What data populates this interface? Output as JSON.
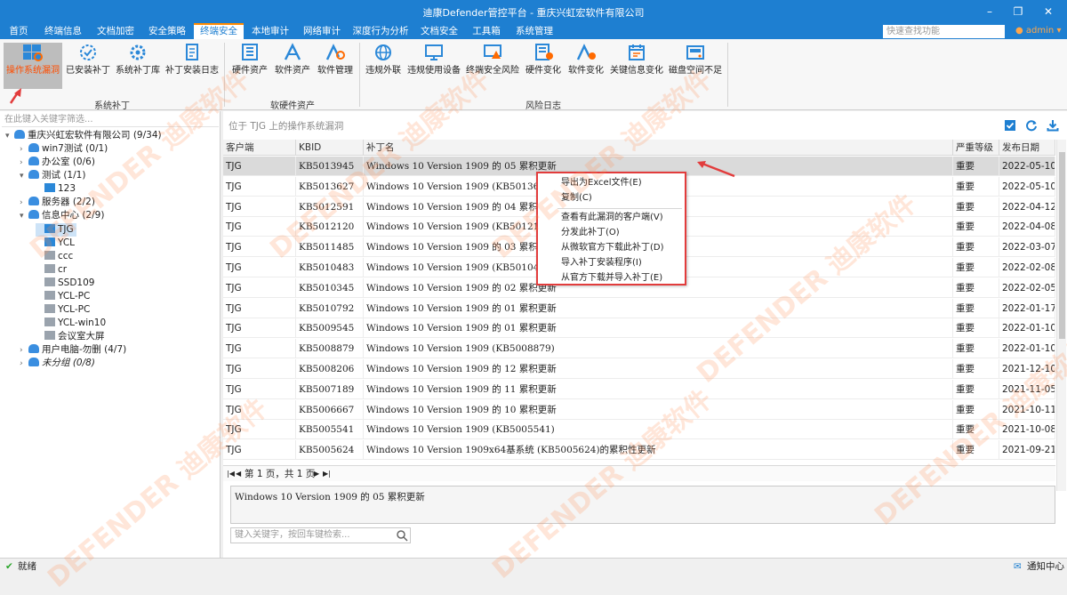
{
  "title": "迪康Defender管控平台 - 重庆兴虹宏软件有限公司",
  "menu": {
    "items": [
      "首页",
      "终端信息",
      "文档加密",
      "安全策略",
      "终端安全",
      "本地审计",
      "网络审计",
      "深度行为分析",
      "文档安全",
      "工具箱",
      "系统管理"
    ],
    "search_placeholder": "快速查找功能",
    "user": "admin"
  },
  "ribbon": {
    "buttons": [
      "操作系统漏洞",
      "已安装补丁",
      "系统补丁库",
      "补丁安装日志",
      "硬件资产",
      "软件资产",
      "软件管理",
      "违规外联",
      "违规使用设备",
      "终端安全风险",
      "硬件变化",
      "软件变化",
      "关键信息变化",
      "磁盘空间不足"
    ],
    "groups": [
      "系统补丁",
      "软硬件资产",
      "风险日志"
    ]
  },
  "tree": {
    "filter_placeholder": "在此键入关键字筛选...",
    "nodes": [
      "重庆兴虹宏软件有限公司 (9/34)",
      "win7测试 (0/1)",
      "办公室 (0/6)",
      "测试 (1/1)",
      "123",
      "服务器 (2/2)",
      "信息中心 (2/9)",
      "TJG",
      "YCL",
      "ccc",
      "cr",
      "SSD109",
      "YCL-PC",
      "YCL-PC",
      "YCL-win10",
      "会议室大屏",
      "用户电脑-勿删 (4/7)",
      "未分组 (0/8)"
    ]
  },
  "main": {
    "location": "位于 TJG 上的操作系统漏洞",
    "columns": [
      "客户端",
      "KBID",
      "补丁名",
      "严重等级",
      "发布日期"
    ],
    "rows": [
      [
        "TJG",
        "KB5013945",
        "Windows 10 Version 1909 的 05 累积更新",
        "重要",
        "2022-05-10"
      ],
      [
        "TJG",
        "KB5013627",
        "Windows 10 Version 1909 (KB5013627)",
        "重要",
        "2022-05-10"
      ],
      [
        "TJG",
        "KB5012591",
        "Windows 10 Version 1909 的 04 累积更新",
        "重要",
        "2022-04-12"
      ],
      [
        "TJG",
        "KB5012120",
        "Windows 10 Version 1909 (KB5012120)",
        "重要",
        "2022-04-08"
      ],
      [
        "TJG",
        "KB5011485",
        "Windows 10 Version 1909 的 03 累积更新",
        "重要",
        "2022-03-07"
      ],
      [
        "TJG",
        "KB5010483",
        "Windows 10 Version 1909 (KB5010483)",
        "重要",
        "2022-02-08"
      ],
      [
        "TJG",
        "KB5010345",
        "Windows 10 Version 1909 的 02 累积更新",
        "重要",
        "2022-02-05"
      ],
      [
        "TJG",
        "KB5010792",
        "Windows 10 Version 1909 的 01 累积更新",
        "重要",
        "2022-01-17"
      ],
      [
        "TJG",
        "KB5009545",
        "Windows 10 Version 1909 的 01 累积更新",
        "重要",
        "2022-01-10"
      ],
      [
        "TJG",
        "KB5008879",
        "Windows 10 Version 1909 (KB5008879)",
        "重要",
        "2022-01-10"
      ],
      [
        "TJG",
        "KB5008206",
        "Windows 10 Version 1909 的 12 累积更新",
        "重要",
        "2021-12-10"
      ],
      [
        "TJG",
        "KB5007189",
        "Windows 10 Version 1909 的 11 累积更新",
        "重要",
        "2021-11-05"
      ],
      [
        "TJG",
        "KB5006667",
        "Windows 10 Version 1909 的 10 累积更新",
        "重要",
        "2021-10-11"
      ],
      [
        "TJG",
        "KB5005541",
        "Windows 10 Version 1909 (KB5005541)",
        "重要",
        "2021-10-08"
      ],
      [
        "TJG",
        "KB5005624",
        "Windows 10 Version 1909x64基系统 (KB5005624)的累积性更新",
        "重要",
        "2021-09-21"
      ]
    ],
    "pager": "第 1 页，共 1 页",
    "detail": "Windows 10 Version 1909 的 05 累积更新",
    "keyword_placeholder": "键入关键字，按回车键检索..."
  },
  "context_menu": [
    "导出为Excel文件(E)",
    "复制(C)",
    "查看有此漏洞的客户端(V)",
    "分发此补丁(O)",
    "从微软官方下载此补丁(D)",
    "导入补丁安装程序(I)",
    "从官方下载并导入补丁(E)"
  ],
  "status": {
    "left": "就绪",
    "right": "通知中心"
  },
  "watermark": [
    "DEFENDER",
    "迪",
    "康",
    "软",
    "件"
  ],
  "colors": {
    "accent": "#1e7fd1",
    "highlight": "#ff8a00",
    "alert": "#e23c3c"
  }
}
